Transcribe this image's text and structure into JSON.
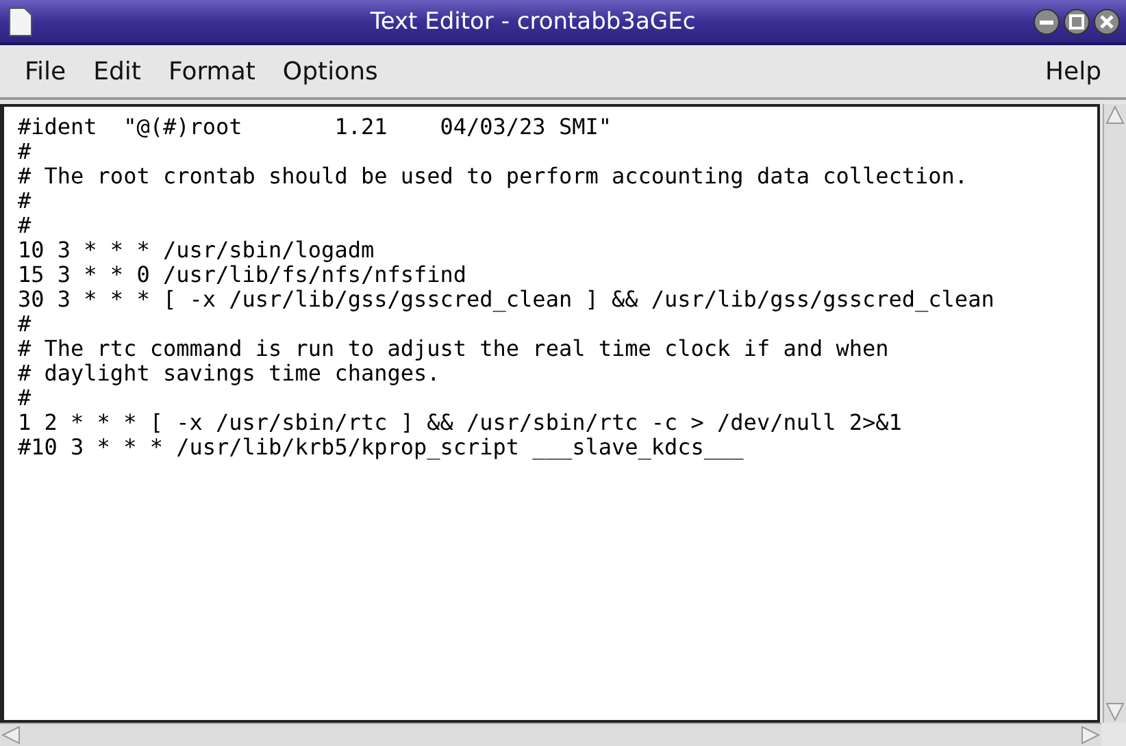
{
  "window": {
    "title": "Text Editor - crontabb3aGEc"
  },
  "menu": {
    "left": [
      "File",
      "Edit",
      "Format",
      "Options"
    ],
    "right": [
      "Help"
    ]
  },
  "lines": [
    "#ident  \"@(#)root       1.21    04/03/23 SMI\"",
    "#",
    "# The root crontab should be used to perform accounting data collection.",
    "#",
    "#",
    "10 3 * * * /usr/sbin/logadm",
    "15 3 * * 0 /usr/lib/fs/nfs/nfsfind",
    "30 3 * * * [ -x /usr/lib/gss/gsscred_clean ] && /usr/lib/gss/gsscred_clean",
    "#",
    "# The rtc command is run to adjust the real time clock if and when",
    "# daylight savings time changes.",
    "#",
    "1 2 * * * [ -x /usr/sbin/rtc ] && /usr/sbin/rtc -c > /dev/null 2>&1",
    "#10 3 * * * /usr/lib/krb5/kprop_script ___slave_kdcs___"
  ]
}
